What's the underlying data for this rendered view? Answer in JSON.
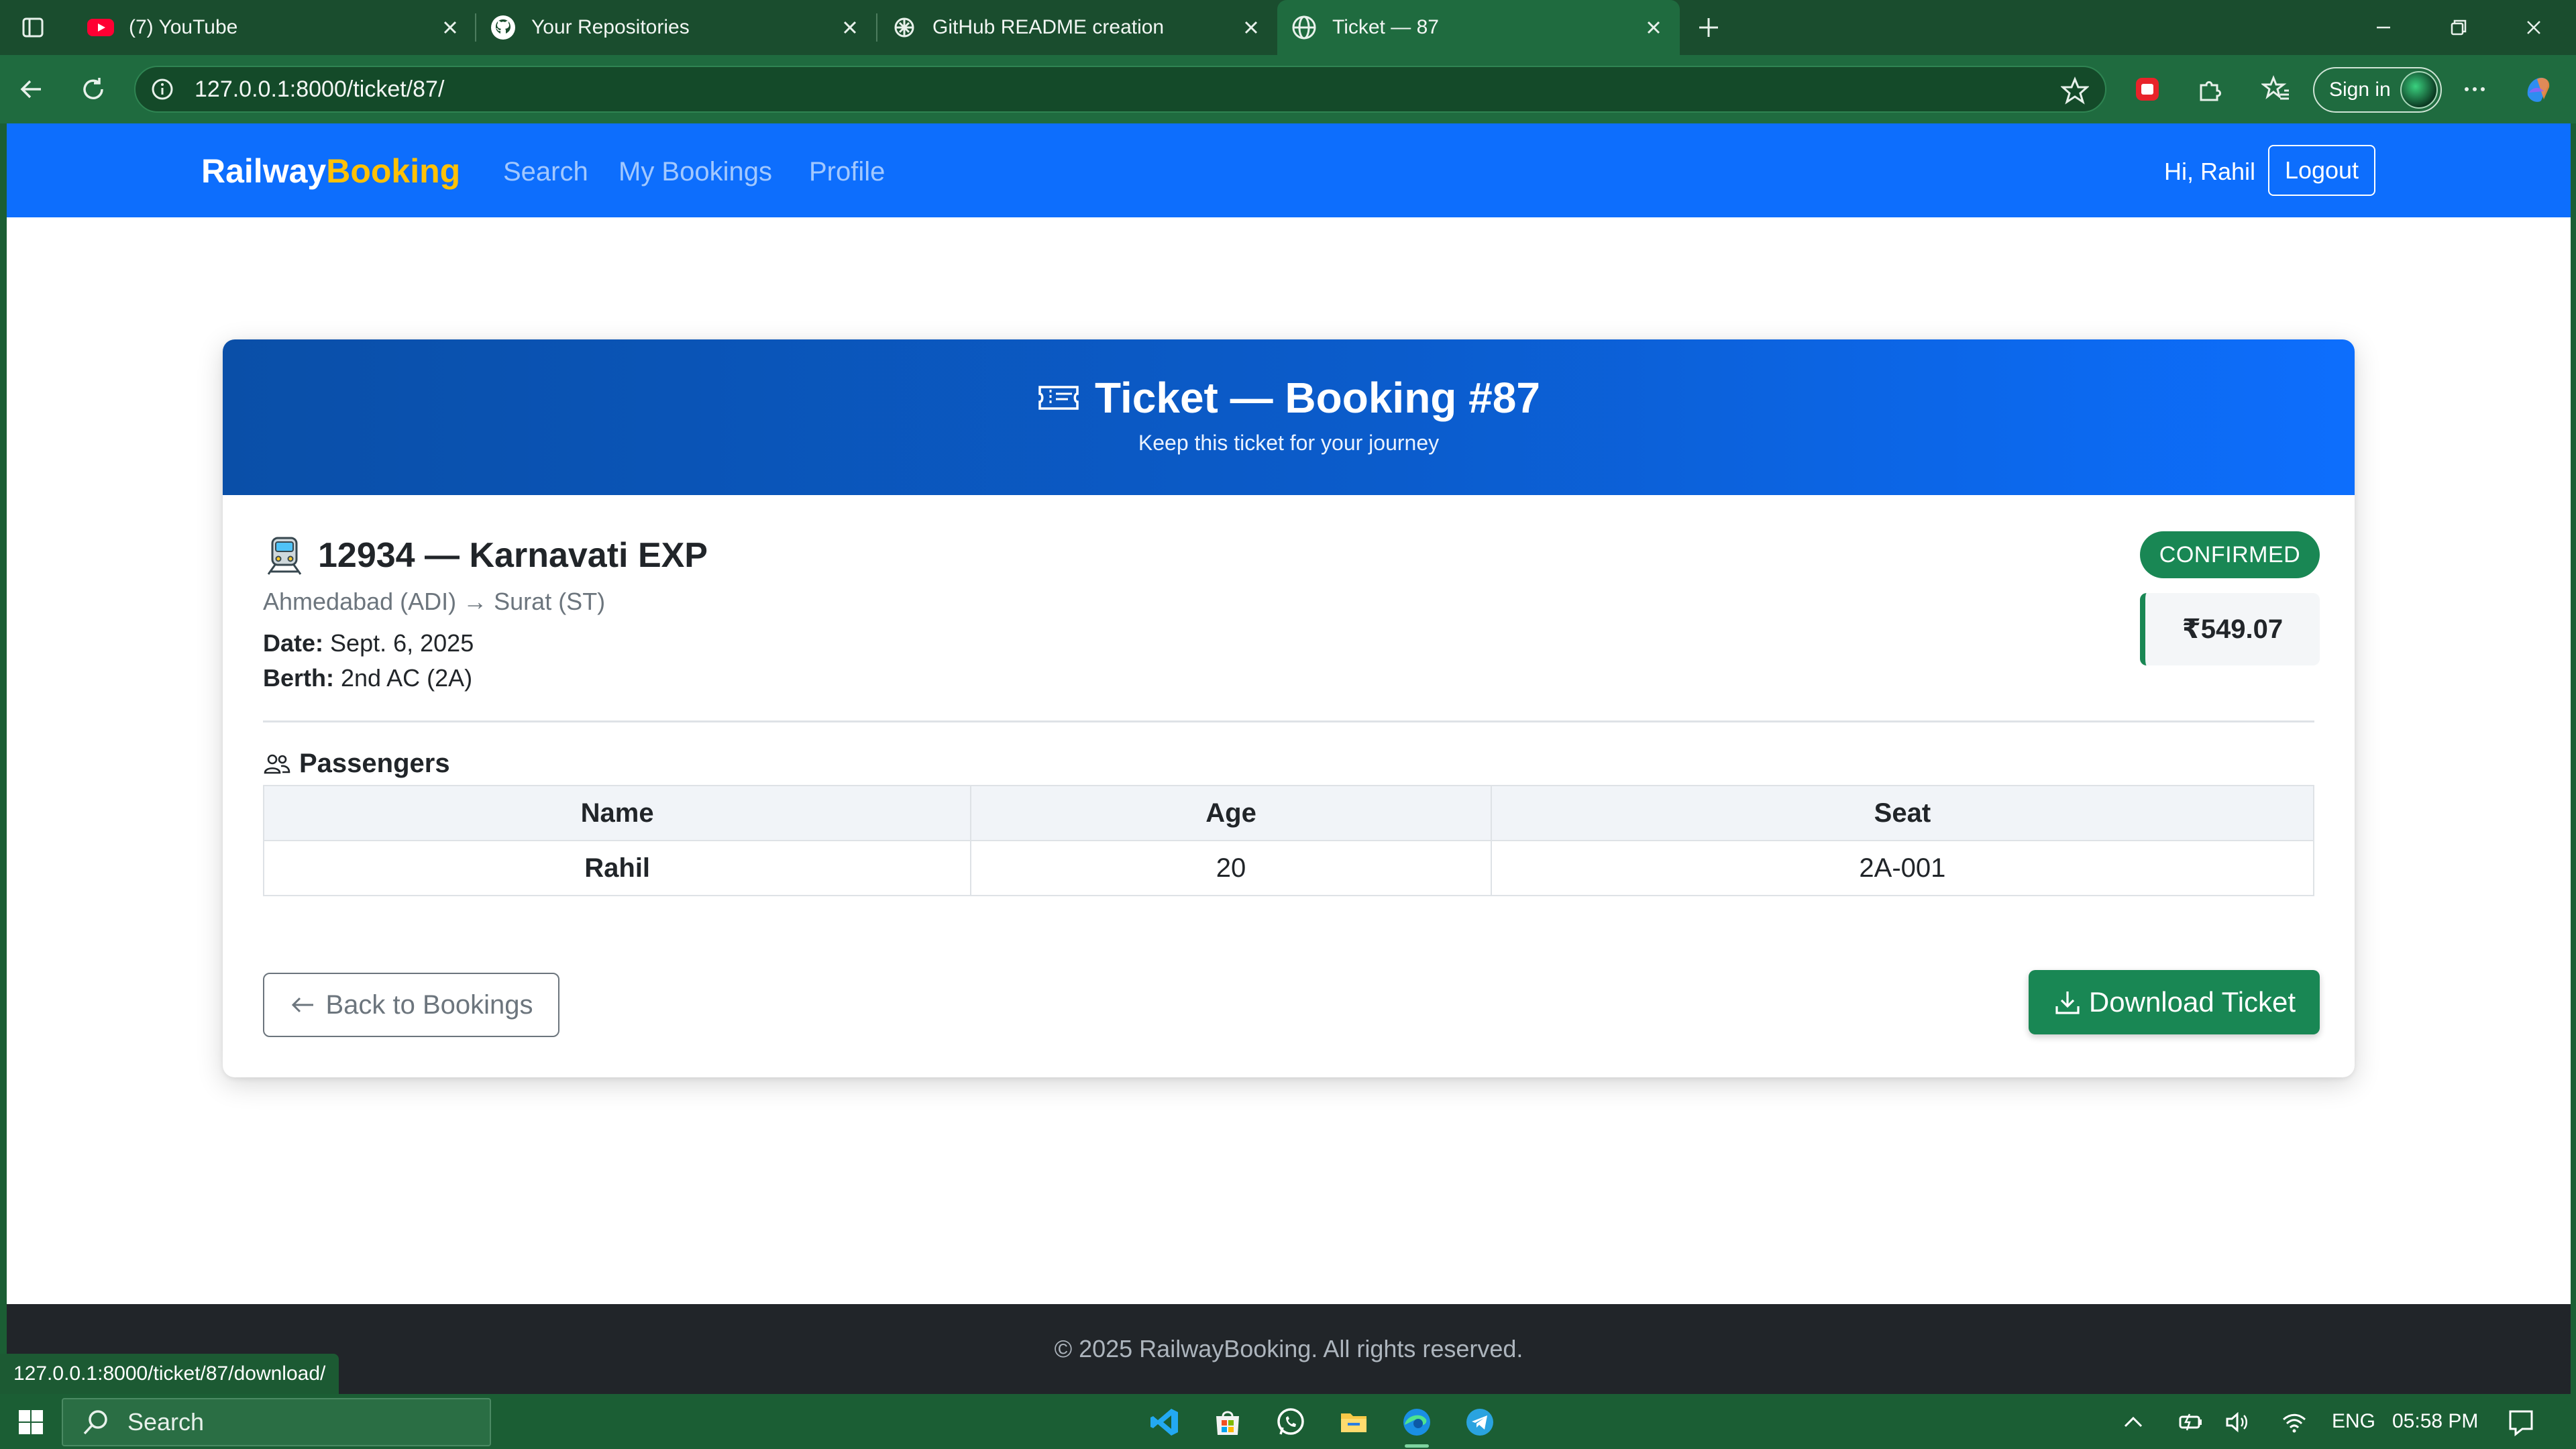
{
  "browser": {
    "tabs": [
      {
        "title": "(7) YouTube",
        "icon": "youtube-icon",
        "active": false
      },
      {
        "title": "Your Repositories",
        "icon": "github-icon",
        "active": false
      },
      {
        "title": "GitHub README creation",
        "icon": "chatgpt-icon",
        "active": false
      },
      {
        "title": "Ticket — 87",
        "icon": "globe-icon",
        "active": true
      }
    ],
    "url": "127.0.0.1:8000/ticket/87/",
    "sign_in_label": "Sign in",
    "status_url": "127.0.0.1:8000/ticket/87/download/",
    "accent_color": "#1f6b3f"
  },
  "navbar": {
    "brand_part1": "Railway",
    "brand_part2": "Booking",
    "links": [
      "Search",
      "My Bookings",
      "Profile"
    ],
    "greeting": "Hi, Rahil",
    "logout_label": "Logout",
    "brand_color": "#0d6efd"
  },
  "ticket": {
    "title": "Ticket — Booking #87",
    "subtitle": "Keep this ticket for your journey",
    "train": "12934 — Karnavati EXP",
    "route": "Ahmedabad (ADI) → Surat (ST)",
    "date_label": "Date:",
    "date_value": "Sept. 6, 2025",
    "berth_label": "Berth:",
    "berth_value": "2nd AC (2A)",
    "status": "CONFIRMED",
    "fare": "₹549.07",
    "status_color": "#198754"
  },
  "passengers": {
    "heading": "Passengers",
    "columns": [
      "Name",
      "Age",
      "Seat"
    ],
    "rows": [
      {
        "name": "Rahil",
        "age": "20",
        "seat": "2A-001"
      }
    ]
  },
  "actions": {
    "back_label": "Back to Bookings",
    "download_label": "Download Ticket"
  },
  "footer": {
    "text": "© 2025 RailwayBooking. All rights reserved."
  },
  "taskbar": {
    "search_placeholder": "Search",
    "language": "ENG",
    "time": "05:58 PM"
  }
}
